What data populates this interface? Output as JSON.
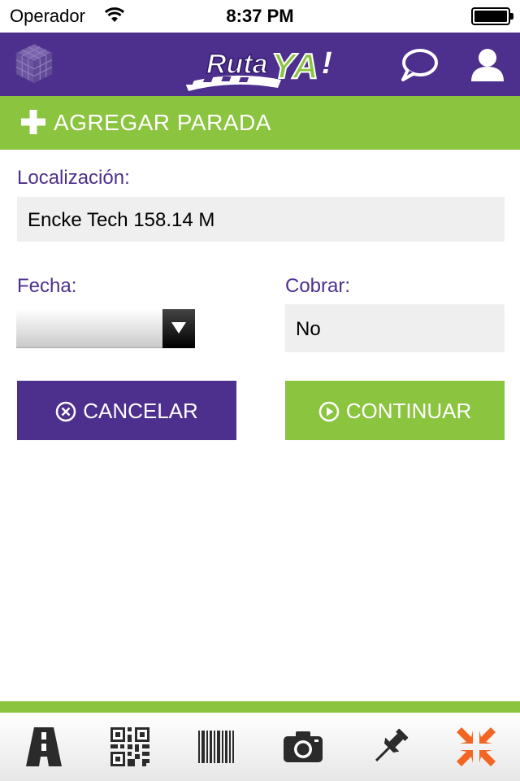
{
  "status_bar": {
    "carrier": "Operador",
    "time": "8:37 PM"
  },
  "header": {
    "logo_text_ruta": "Ruta",
    "logo_text_ya": "YA",
    "logo_exclamation": "!",
    "icons": [
      "cube-icon",
      "chat-icon",
      "user-icon"
    ]
  },
  "add_stop": {
    "title": "AGREGAR PARADA",
    "icon": "plus-icon"
  },
  "form": {
    "location_label": "Localización:",
    "location_value": "Encke Tech 158.14 M",
    "date_label": "Fecha:",
    "date_value": "",
    "charge_label": "Cobrar:",
    "charge_value": "No"
  },
  "buttons": {
    "cancel_label": "CANCELAR",
    "continue_label": "CONTINUAR"
  },
  "toolbar": {
    "items": [
      "road-icon",
      "qr-code-icon",
      "barcode-icon",
      "camera-icon",
      "pin-icon",
      "collapse-arrows-icon"
    ],
    "active": "collapse-arrows-icon"
  },
  "colors": {
    "purple": "#4d2f8e",
    "green": "#8bc43f",
    "orange": "#f26522",
    "field_bg": "#efefef"
  }
}
